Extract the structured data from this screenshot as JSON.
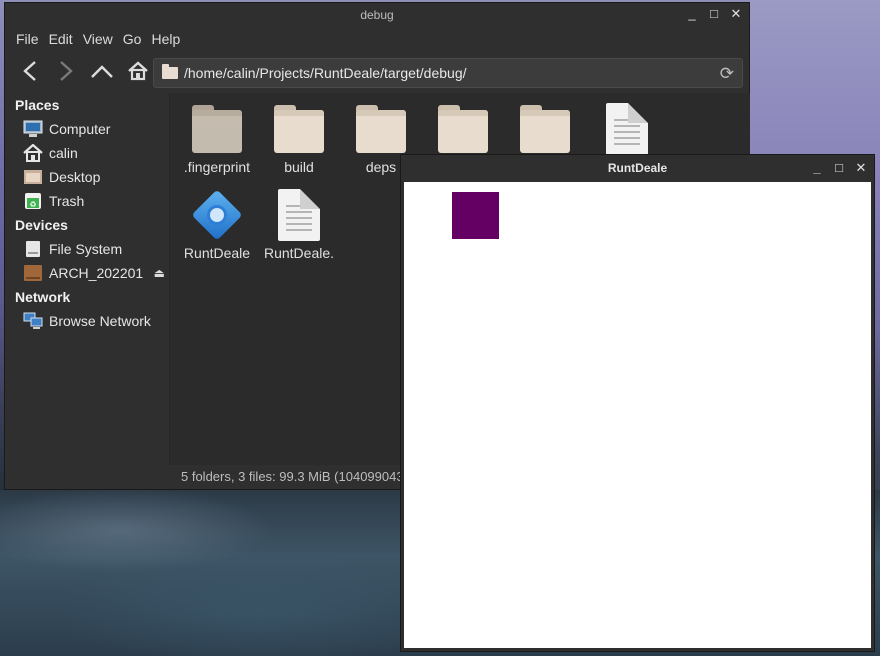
{
  "desktop": {},
  "file_manager": {
    "title": "debug",
    "window_controls": {
      "minimize": "_",
      "maximize": "□",
      "close": "✕"
    },
    "menu": [
      "File",
      "Edit",
      "View",
      "Go",
      "Help"
    ],
    "path": "/home/calin/Projects/RuntDeale/target/debug/",
    "sidebar": {
      "places_heading": "Places",
      "places": [
        "Computer",
        "calin",
        "Desktop",
        "Trash"
      ],
      "devices_heading": "Devices",
      "devices": [
        "File System",
        "ARCH_202201"
      ],
      "network_heading": "Network",
      "network": [
        "Browse Network"
      ]
    },
    "files": [
      {
        "name": ".fingerprint",
        "kind": "folder",
        "shade": "dark"
      },
      {
        "name": "build",
        "kind": "folder"
      },
      {
        "name": "deps",
        "kind": "folder"
      },
      {
        "name": "",
        "kind": "folder"
      },
      {
        "name": "",
        "kind": "folder"
      },
      {
        "name": "",
        "kind": "document"
      },
      {
        "name": "RuntDeale",
        "kind": "application"
      },
      {
        "name": "RuntDeale.",
        "kind": "document"
      }
    ],
    "status": "5 folders, 3 files: 99.3 MiB (104099043"
  },
  "app_window": {
    "title": "RuntDeale",
    "window_controls": {
      "minimize": "_",
      "maximize": "□",
      "close": "✕"
    },
    "square_color": "#640064"
  }
}
